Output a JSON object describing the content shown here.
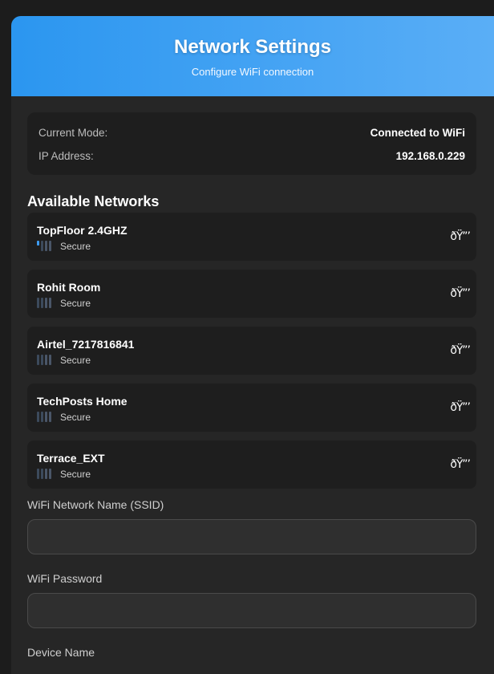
{
  "header": {
    "title": "Network Settings",
    "subtitle": "Configure WiFi connection"
  },
  "status": {
    "mode_label": "Current Mode:",
    "mode_value": "Connected to WiFi",
    "ip_label": "IP Address:",
    "ip_value": "192.168.0.229"
  },
  "networks": {
    "title": "Available Networks",
    "items": [
      {
        "name": "TopFloor 2.4GHZ",
        "security": "Secure",
        "lock_glyph": "ðŸ”’",
        "signal_level": 1
      },
      {
        "name": "Rohit Room",
        "security": "Secure",
        "lock_glyph": "ðŸ”’",
        "signal_level": 0
      },
      {
        "name": "Airtel_7217816841",
        "security": "Secure",
        "lock_glyph": "ðŸ”’",
        "signal_level": 0
      },
      {
        "name": "TechPosts Home",
        "security": "Secure",
        "lock_glyph": "ðŸ”’",
        "signal_level": 0
      },
      {
        "name": "Terrace_EXT",
        "security": "Secure",
        "lock_glyph": "ðŸ”’",
        "signal_level": 0
      }
    ]
  },
  "form": {
    "ssid_label": "WiFi Network Name (SSID)",
    "ssid_value": "",
    "password_label": "WiFi Password",
    "password_value": "",
    "device_label": "Device Name"
  },
  "colors": {
    "accent": "#2b96f0",
    "background": "#1c1c1c",
    "card": "#262626"
  }
}
